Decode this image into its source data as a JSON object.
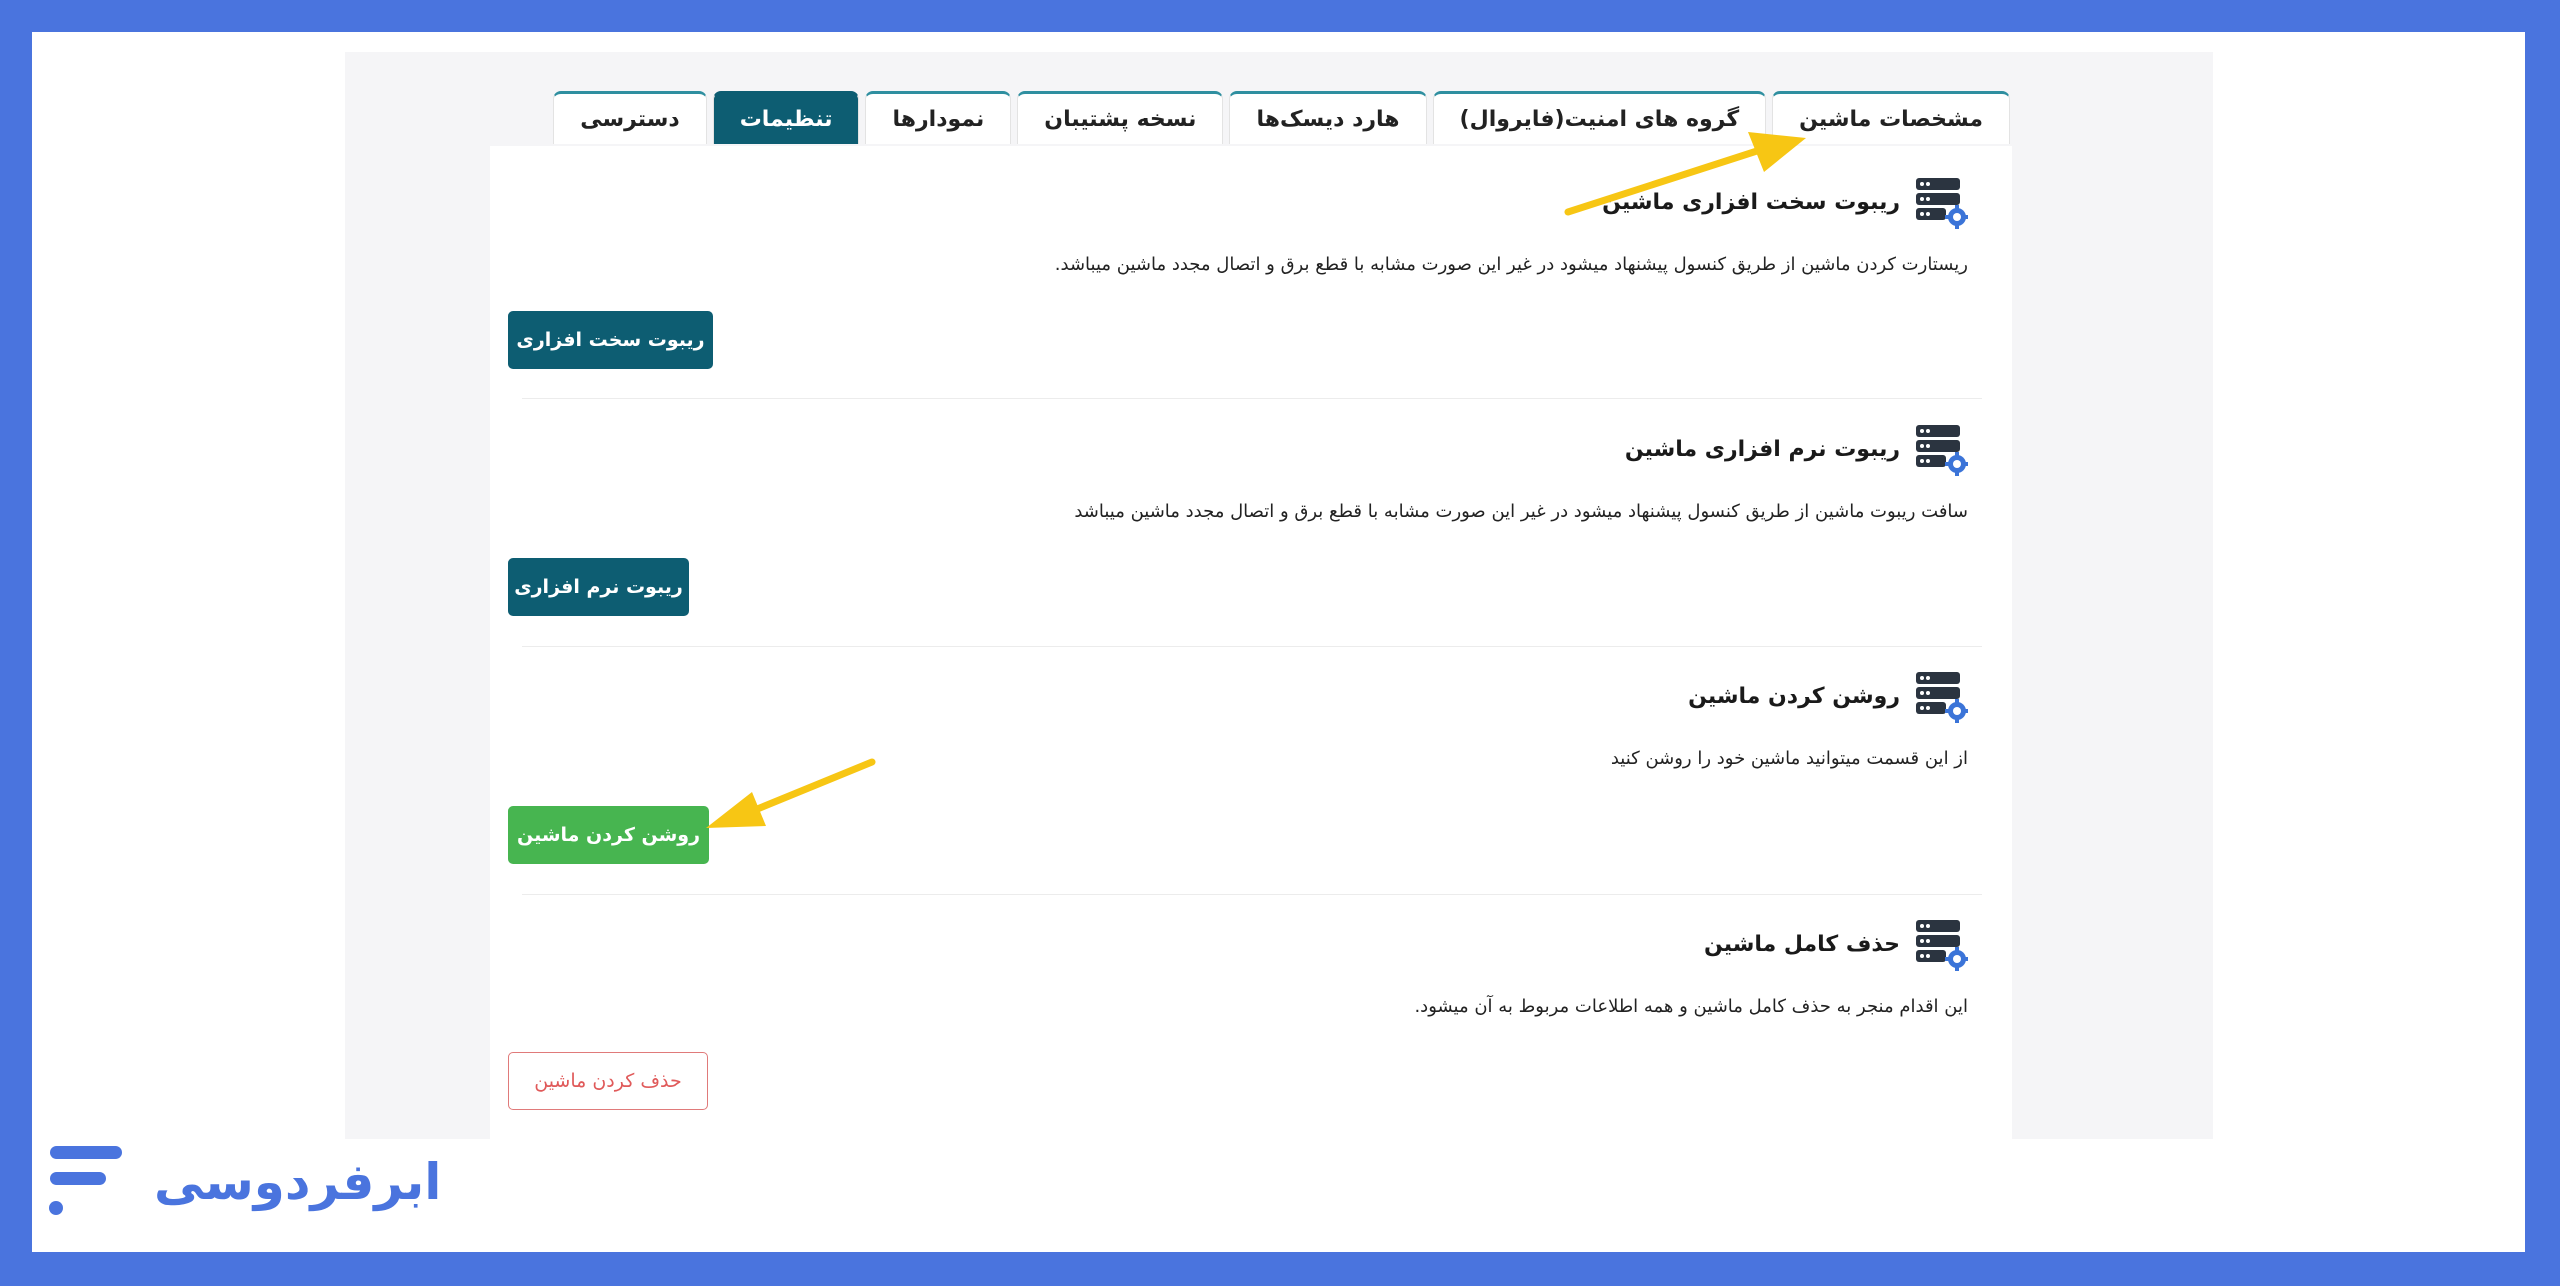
{
  "tabs": [
    {
      "label": "دسترسی",
      "active": false
    },
    {
      "label": "تنظیمات",
      "active": true
    },
    {
      "label": "نمودارها",
      "active": false
    },
    {
      "label": "نسخه پشتیبان",
      "active": false
    },
    {
      "label": "هارد دیسک‌ها",
      "active": false
    },
    {
      "label": "گروه های امنیت(فایروال)",
      "active": false
    },
    {
      "label": "مشخصات ماشین",
      "active": false
    }
  ],
  "sections": {
    "hard_reboot": {
      "title": "ریبوت سخت افزاری ماشین",
      "description": "ریستارت کردن ماشین از طریق کنسول پیشنهاد میشود در غیر این صورت مشابه با قطع برق و اتصال مجدد ماشین میباشد.",
      "button": "ریبوت سخت افزاری"
    },
    "soft_reboot": {
      "title": "ریبوت نرم افزاری ماشین",
      "description": "سافت ریبوت ماشین از طریق کنسول پیشنهاد میشود در غیر این صورت مشابه با قطع برق و اتصال مجدد ماشین میباشد",
      "button": "ریبوت نرم افزاری"
    },
    "power_on": {
      "title": "روشن کردن ماشین",
      "description": "از این قسمت میتوانید ماشین خود را روشن کنید",
      "button": "روشن کردن ماشین"
    },
    "delete": {
      "title": "حذف کامل ماشین",
      "description": "این اقدام منجر به حذف کامل ماشین و همه اطلاعات مربوط به آن میشود.",
      "button": "حذف کردن ماشین"
    }
  },
  "brand": {
    "name": "ابرفردوسی"
  },
  "colors": {
    "accent": "#0d5d72",
    "success": "#47b550",
    "danger": "#e05a5a",
    "frame": "#4a74de",
    "arrow": "#f7c614"
  }
}
